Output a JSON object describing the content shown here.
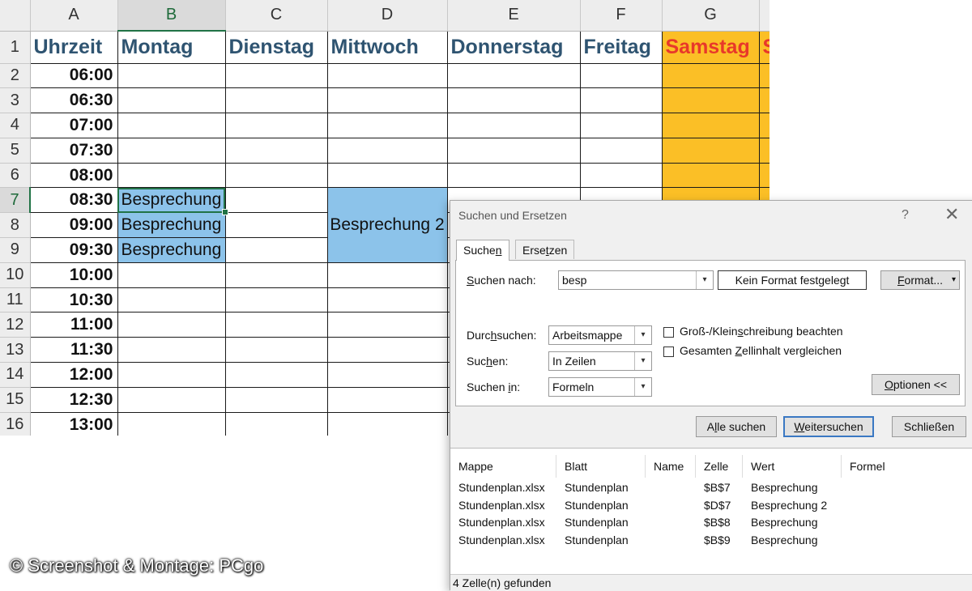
{
  "sheet": {
    "columns": [
      "A",
      "B",
      "C",
      "D",
      "E",
      "F",
      "G"
    ],
    "rows": [
      "1",
      "2",
      "3",
      "4",
      "5",
      "6",
      "7",
      "8",
      "9",
      "10",
      "11",
      "12",
      "13",
      "14",
      "15",
      "16"
    ],
    "headers": [
      "Uhrzeit",
      "Montag",
      "Dienstag",
      "Mittwoch",
      "Donnerstag",
      "Freitag",
      "Samstag",
      "S"
    ],
    "times": [
      "06:00",
      "06:30",
      "07:00",
      "07:30",
      "08:00",
      "08:30",
      "09:00",
      "09:30",
      "10:00",
      "10:30",
      "11:00",
      "11:30",
      "12:00",
      "12:30",
      "13:00"
    ],
    "b7": "Besprechung",
    "b8": "Besprechung",
    "b9": "Besprechung",
    "d8": "Besprechung 2",
    "colors": {
      "header_text": "#2f5471",
      "weekend_text": "#e8382a",
      "weekend_fill": "#fbbf26",
      "meeting_fill": "#8cc3ea",
      "selection": "#217346"
    }
  },
  "dialog": {
    "title": "Suchen und Ersetzen",
    "help": "?",
    "close": "✕",
    "tabs": {
      "search_pre": "Suche",
      "search_u": "n",
      "replace_pre": "Erse",
      "replace_u": "t",
      "replace_post": "zen"
    },
    "search_label": {
      "pre": "",
      "u": "S",
      "post": "uchen nach:"
    },
    "search_value": "besp",
    "no_format": "Kein Format festgelegt",
    "format_button": {
      "pre": "",
      "u": "F",
      "post": "ormat..."
    },
    "dropdown_arrow": "▾",
    "within_label": {
      "pre": "Durc",
      "u": "h",
      "post": "suchen:"
    },
    "within_value": "Arbeitsmappe",
    "search_dir_label": {
      "pre": "Suc",
      "u": "h",
      "post": "en:"
    },
    "search_dir_value": "In Zeilen",
    "look_in_label": {
      "pre": "Suchen ",
      "u": "i",
      "post": "n:"
    },
    "look_in_value": "Formeln",
    "match_case": {
      "pre": "Groß-/Klein",
      "u": "s",
      "post": "chreibung beachten"
    },
    "match_entire": {
      "pre": "Gesamten ",
      "u": "Z",
      "post": "ellinhalt vergleichen"
    },
    "options_button": {
      "pre": "",
      "u": "O",
      "post": "ptionen <<"
    },
    "find_all": {
      "pre": "A",
      "u": "l",
      "post": "le suchen"
    },
    "find_next": {
      "pre": "",
      "u": "W",
      "post": "eitersuchen"
    },
    "close_button": "Schließen",
    "results": {
      "headers": [
        "Mappe",
        "Blatt",
        "Name",
        "Zelle",
        "Wert",
        "Formel"
      ],
      "rows": [
        {
          "mappe": "Stundenplan.xlsx",
          "blatt": "Stundenplan",
          "name": "",
          "zelle": "$B$7",
          "wert": "Besprechung",
          "formel": ""
        },
        {
          "mappe": "Stundenplan.xlsx",
          "blatt": "Stundenplan",
          "name": "",
          "zelle": "$D$7",
          "wert": "Besprechung 2",
          "formel": ""
        },
        {
          "mappe": "Stundenplan.xlsx",
          "blatt": "Stundenplan",
          "name": "",
          "zelle": "$B$8",
          "wert": "Besprechung",
          "formel": ""
        },
        {
          "mappe": "Stundenplan.xlsx",
          "blatt": "Stundenplan",
          "name": "",
          "zelle": "$B$9",
          "wert": "Besprechung",
          "formel": ""
        }
      ]
    },
    "status": "4 Zelle(n) gefunden"
  },
  "credit": "© Screenshot & Montage: PCgo"
}
